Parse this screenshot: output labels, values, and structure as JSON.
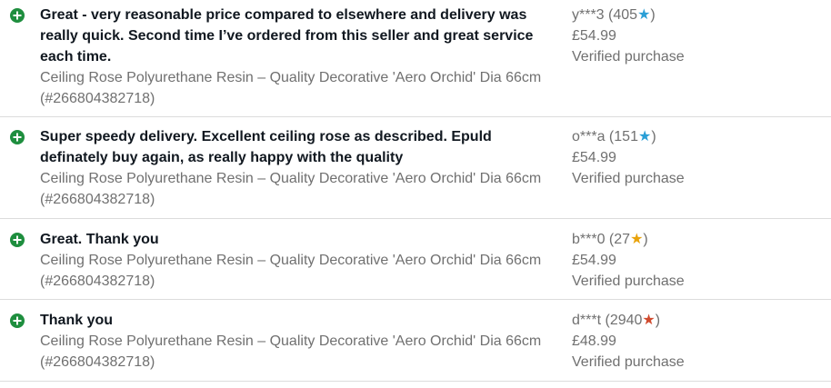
{
  "feedback": [
    {
      "comment": "Great - very reasonable price compared to elsewhere and delivery was really quick. Second time I’ve ordered from this seller and great service each time.",
      "item_title": "Ceiling Rose Polyurethane Resin – Quality Decorative 'Aero Orchid' Dia 66cm (#266804382718)",
      "buyer": "y***3",
      "score": "405",
      "star_color": "#2a9fd6",
      "price": "£54.99",
      "verified": "Verified purchase"
    },
    {
      "comment": "Super speedy delivery. Excellent ceiling rose as described. Epuld definately buy again, as really happy with the quality",
      "item_title": "Ceiling Rose Polyurethane Resin – Quality Decorative 'Aero Orchid' Dia 66cm (#266804382718)",
      "buyer": "o***a",
      "score": "151",
      "star_color": "#2a9fd6",
      "price": "£54.99",
      "verified": "Verified purchase"
    },
    {
      "comment": "Great. Thank you",
      "item_title": "Ceiling Rose Polyurethane Resin – Quality Decorative 'Aero Orchid' Dia 66cm (#266804382718)",
      "buyer": "b***0",
      "score": "27",
      "star_color": "#e9a30b",
      "price": "£54.99",
      "verified": "Verified purchase"
    },
    {
      "comment": "Thank you",
      "item_title": "Ceiling Rose Polyurethane Resin – Quality Decorative 'Aero Orchid' Dia 66cm (#266804382718)",
      "buyer": "d***t",
      "score": "2940",
      "star_color": "#d04a2e",
      "price": "£48.99",
      "verified": "Verified purchase"
    }
  ],
  "icons": {
    "rating": "positive-feedback-plus-icon",
    "score": "feedback-star-icon"
  }
}
